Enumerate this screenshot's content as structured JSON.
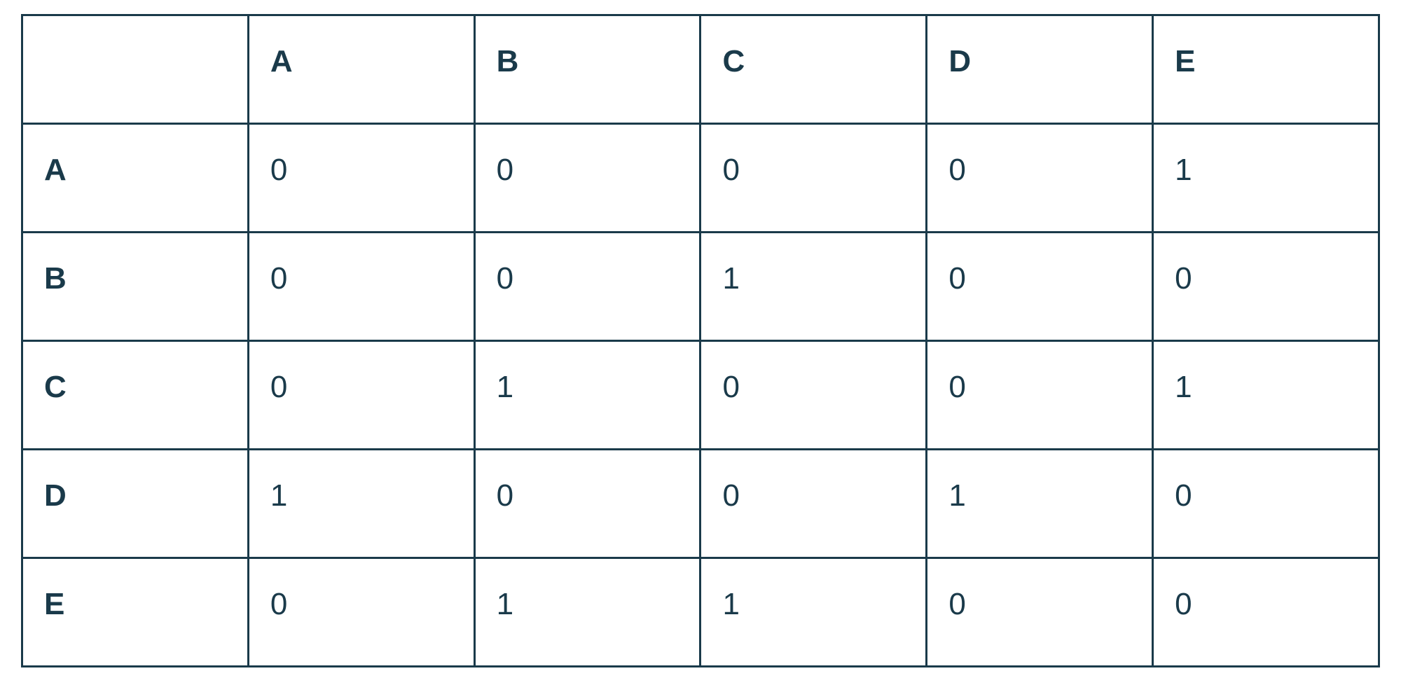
{
  "chart_data": {
    "type": "table",
    "title": "",
    "columns": [
      "A",
      "B",
      "C",
      "D",
      "E"
    ],
    "rows": [
      "A",
      "B",
      "C",
      "D",
      "E"
    ],
    "values": [
      [
        0,
        0,
        0,
        0,
        1
      ],
      [
        0,
        0,
        1,
        0,
        0
      ],
      [
        0,
        1,
        0,
        0,
        1
      ],
      [
        1,
        0,
        0,
        1,
        0
      ],
      [
        0,
        1,
        1,
        0,
        0
      ]
    ]
  }
}
